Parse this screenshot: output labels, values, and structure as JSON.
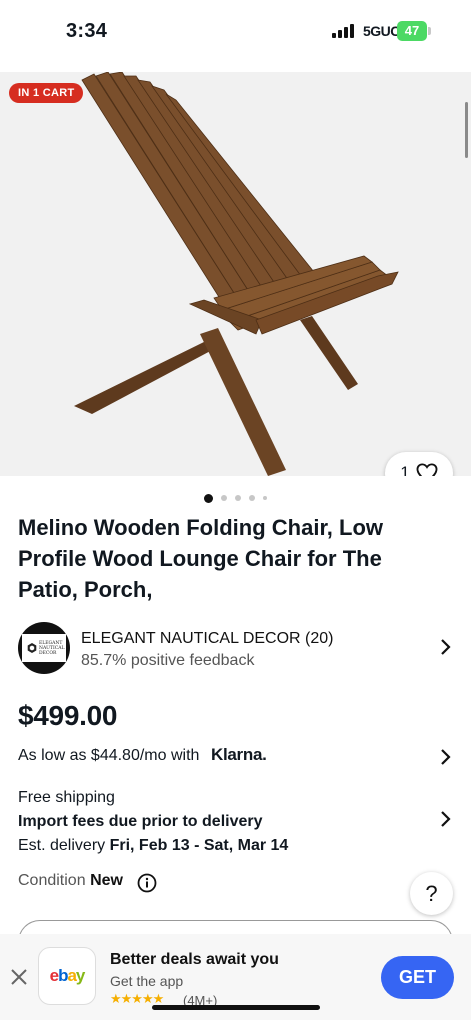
{
  "status_bar": {
    "time": "3:34",
    "network": "5GUC",
    "battery": "47"
  },
  "hero": {
    "badge": "IN 1 CART",
    "watch_count": "1",
    "image_count": 5,
    "active_image_index": 0
  },
  "listing": {
    "title": "Melino Wooden Folding Chair, Low Profile Wood Lounge Chair for The Patio, Porch,",
    "price": "$499.00"
  },
  "seller": {
    "logo_text": "ELEGANT NAUTICAL DECOR",
    "name": "ELEGANT NAUTICAL DECOR (20)",
    "feedback": "85.7% positive feedback"
  },
  "financing": {
    "text": "As low as $44.80/mo with",
    "provider": "Klarna."
  },
  "shipping": {
    "line1": "Free shipping",
    "line2": "Import fees due prior to delivery",
    "est_label": "Est. delivery",
    "est_dates": "Fri, Feb 13 - Sat, Mar 14"
  },
  "condition": {
    "label": "Condition",
    "value": "New"
  },
  "help": {
    "label": "?"
  },
  "app_banner": {
    "title": "Better deals await you",
    "subtitle": "Get the app",
    "stars": "★★★★★",
    "rating_count": "(4M+)",
    "cta": "GET",
    "icon": {
      "e": "e",
      "b": "b",
      "a": "a",
      "y": "y"
    }
  },
  "colors": {
    "badge": "#d62d20",
    "cta": "#3665f3",
    "chair_wood": "#6b4424"
  }
}
